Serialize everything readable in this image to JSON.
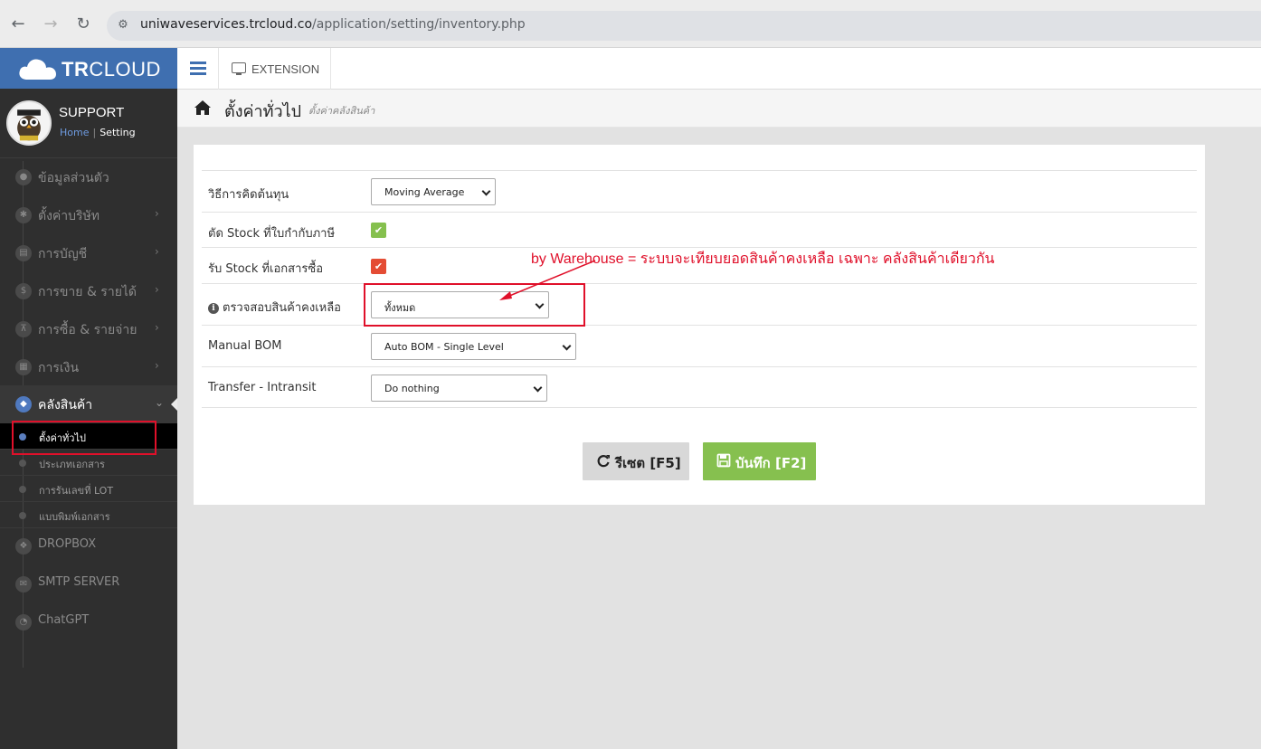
{
  "browser": {
    "url_host": "uniwaveservices.trcloud.co",
    "url_path": "/application/setting/inventory.php"
  },
  "sidebar": {
    "logo": "TRCLOUD",
    "profile": {
      "name": "SUPPORT",
      "home_link": "Home",
      "current": "Setting"
    },
    "menu": [
      {
        "label": "ข้อมูลส่วนตัว",
        "icon": "user-icon"
      },
      {
        "label": "ตั้งค่าบริษัท",
        "icon": "gear-icon"
      },
      {
        "label": "การบัญชี",
        "icon": "book-icon"
      },
      {
        "label": "การขาย & รายได้",
        "icon": "dollar-icon"
      },
      {
        "label": "การซื้อ & รายจ่าย",
        "icon": "cart-icon"
      },
      {
        "label": "การเงิน",
        "icon": "calendar-icon"
      },
      {
        "label": "คลังสินค้า",
        "icon": "box-icon"
      }
    ],
    "submenu": [
      {
        "label": "ตั้งค่าทั่วไป"
      },
      {
        "label": "ประเภทเอกสาร"
      },
      {
        "label": "การรันเลขที่ LOT"
      },
      {
        "label": "แบบพิมพ์เอกสาร"
      }
    ],
    "menu_bottom": [
      {
        "label": "DROPBOX",
        "icon": "dropbox-icon"
      },
      {
        "label": "SMTP SERVER",
        "icon": "envelope-icon"
      },
      {
        "label": "ChatGPT",
        "icon": "chat-icon"
      }
    ]
  },
  "topnav": {
    "extension_label": "EXTENSION"
  },
  "header": {
    "title": "ตั้งค่าทั่วไป",
    "subtitle": "ตั้งค่าคลังสินค้า"
  },
  "form": {
    "rows": [
      {
        "label": "วิธีการคิดต้นทุน",
        "value": "Moving Average"
      },
      {
        "label": "ตัด Stock ที่ใบกำกับภาษี",
        "checked": true
      },
      {
        "label": "รับ Stock ที่เอกสารซื้อ",
        "checked": true
      },
      {
        "label": "ตรวจสอบสินค้าคงเหลือ",
        "value": "ทั้งหมด"
      },
      {
        "label": "Manual BOM",
        "value": "Auto BOM - Single Level"
      },
      {
        "label": "Transfer - Intransit",
        "value": "Do nothing"
      }
    ]
  },
  "annotation": "by Warehouse = ระบบจะเทียบยอดสินค้าคงเหลือ เฉพาะ คลังสินค้าเดียวกัน",
  "buttons": {
    "reset": "รีเซต [F5]",
    "save": "บันทึก [F2]"
  },
  "colors": {
    "brand": "#3f6fb0",
    "save_green": "#86c04f",
    "annotation_red": "#e0102a"
  }
}
